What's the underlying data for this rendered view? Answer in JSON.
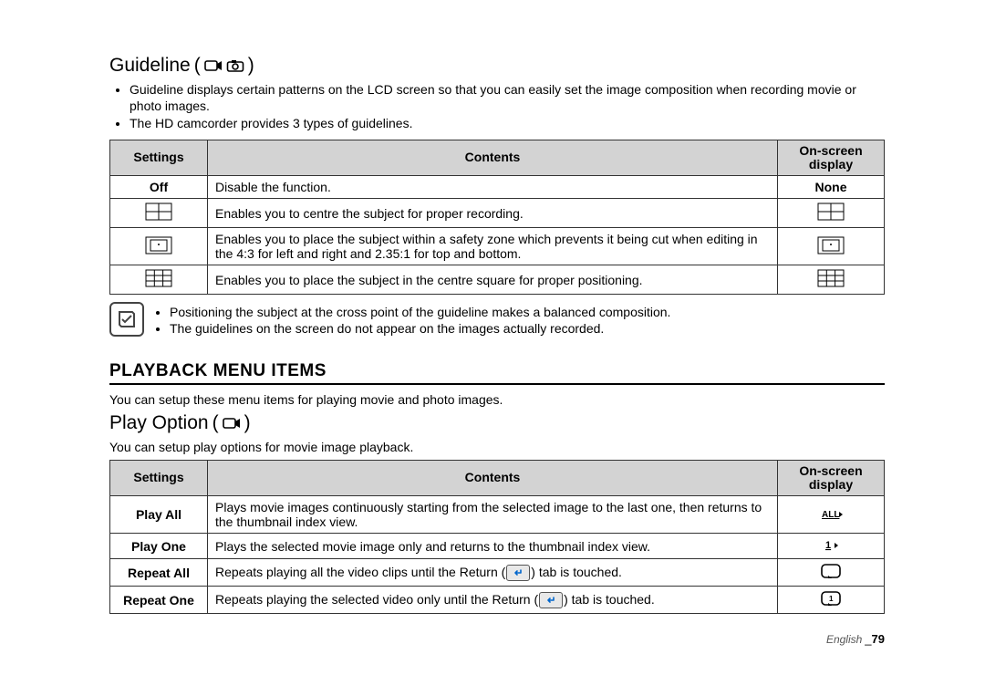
{
  "guideline": {
    "title": "Guideline",
    "bullets": [
      "Guideline displays certain patterns on the LCD screen so that you can easily set the image composition when recording movie or photo images.",
      "The HD camcorder provides 3 types of guidelines."
    ],
    "table": {
      "head": {
        "settings": "Settings",
        "contents": "Contents",
        "osd": "On-screen display"
      },
      "rows": [
        {
          "setting": "Off",
          "content": "Disable the function.",
          "osd": "None",
          "icon": "none"
        },
        {
          "setting": "",
          "content": "Enables you to centre the subject for proper recording.",
          "osd": "",
          "icon": "cross"
        },
        {
          "setting": "",
          "content": "Enables you to place the subject within a safety zone which prevents it being cut when editing in the 4:3 for left and right and 2.35:1 for top and bottom.",
          "osd": "",
          "icon": "safety"
        },
        {
          "setting": "",
          "content": "Enables you to place the subject in the centre square for proper positioning.",
          "osd": "",
          "icon": "grid"
        }
      ]
    },
    "notes": [
      "Positioning the subject at the cross point of the guideline makes a balanced composition.",
      "The guidelines on the screen do not appear on the images actually recorded."
    ]
  },
  "playback": {
    "section_title": "PLAYBACK MENU ITEMS",
    "section_intro": "You can setup these menu items for playing movie and photo images.",
    "play_option_title": "Play Option",
    "play_option_intro": "You can setup play options for movie image playback.",
    "table": {
      "head": {
        "settings": "Settings",
        "contents": "Contents",
        "osd": "On-screen display"
      },
      "rows": [
        {
          "setting": "Play All",
          "content_pre": "Plays movie images continuously starting from the selected image to the last one, then returns to the thumbnail index view.",
          "content_post": "",
          "has_return": false,
          "icon": "all"
        },
        {
          "setting": "Play One",
          "content_pre": "Plays the selected movie image only and returns to the thumbnail index view.",
          "content_post": "",
          "has_return": false,
          "icon": "one"
        },
        {
          "setting": "Repeat All",
          "content_pre": "Repeats playing all the video clips until the Return (",
          "content_post": ") tab is touched.",
          "has_return": true,
          "icon": "repeat-all"
        },
        {
          "setting": "Repeat One",
          "content_pre": "Repeats playing the selected video only until the Return (",
          "content_post": ") tab is touched.",
          "has_return": true,
          "icon": "repeat-one"
        }
      ]
    }
  },
  "footer": {
    "lang": "English",
    "sep": "_",
    "page": "79"
  }
}
